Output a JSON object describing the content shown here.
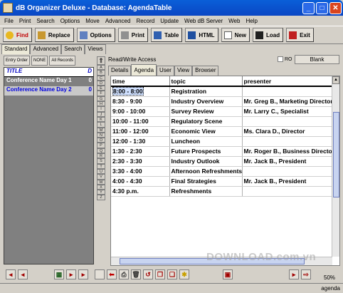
{
  "window": {
    "title": "dB Organizer Deluxe - Database: AgendaTable"
  },
  "menu": [
    "File",
    "Print",
    "Search",
    "Options",
    "Move",
    "Advanced",
    "Record",
    "Update",
    "Web dB Server",
    "Web",
    "Help"
  ],
  "toolbar": [
    {
      "label": "Find",
      "icon": "key-icon"
    },
    {
      "label": "Replace",
      "icon": "replace-icon"
    },
    {
      "label": "Options",
      "icon": "options-icon"
    },
    {
      "label": "Print",
      "icon": "printer-icon"
    },
    {
      "label": "Table",
      "icon": "table-icon"
    },
    {
      "label": "HTML",
      "icon": "html-icon"
    },
    {
      "label": "New",
      "icon": "new-icon"
    },
    {
      "label": "Load",
      "icon": "load-icon"
    },
    {
      "label": "Exit",
      "icon": "exit-icon"
    }
  ],
  "mode_tabs": [
    "Standard",
    "Advanced",
    "Search",
    "Views"
  ],
  "left": {
    "buttons": [
      "Entry Order",
      "NONE",
      "All Records"
    ],
    "header": "TITLE",
    "header_col2": "D",
    "rows": [
      {
        "title": "Conference Name Day 1",
        "d": "0"
      },
      {
        "title": "Conference Name Day 2",
        "d": "0"
      }
    ]
  },
  "alphabet": [
    "A",
    "B",
    "C",
    "D",
    "E",
    "F",
    "G",
    "H",
    "I",
    "J",
    "K",
    "L",
    "M",
    "N",
    "O",
    "P",
    "Q",
    "R",
    "S",
    "T",
    "U",
    "V",
    "W",
    "X",
    "Y",
    "Z"
  ],
  "access_text": "Read/Write Access",
  "ro_label": "RO",
  "blank_label": "Blank",
  "view_tabs": [
    "Details",
    "Agenda",
    "User",
    "View",
    "Browser"
  ],
  "grid": {
    "columns": [
      "time",
      "topic",
      "presenter"
    ],
    "rows": [
      [
        "8:00 - 8:00",
        "Registration",
        ""
      ],
      [
        "8:30 - 9:00",
        "Industry Overview",
        "Mr. Greg B., Marketing Director"
      ],
      [
        "9:00 - 10:00",
        "Survey Review",
        "Mr. Larry C., Specialist"
      ],
      [
        "10:00 - 11:00",
        "Regulatory Scene",
        ""
      ],
      [
        "11:00 - 12:00",
        "Economic View",
        "Ms. Clara D., Director"
      ],
      [
        "12:00 - 1:30",
        "Luncheon",
        ""
      ],
      [
        "1:30 - 2:30",
        "Future Prospects",
        "Mr. Roger B., Business Director"
      ],
      [
        "2:30 - 3:30",
        "Industry Outlook",
        "Mr. Jack B., President"
      ],
      [
        "3:30 - 4:00",
        "Afternoon Refreshments",
        ""
      ],
      [
        "4:00 - 4:30",
        "Final Strategies",
        "Mr. Jack B., President"
      ],
      [
        "4:30 p.m.",
        "Refreshments",
        ""
      ]
    ]
  },
  "watermark": "DOWNLOAD.com.vn",
  "zoom": "50%",
  "status_label": "agenda"
}
